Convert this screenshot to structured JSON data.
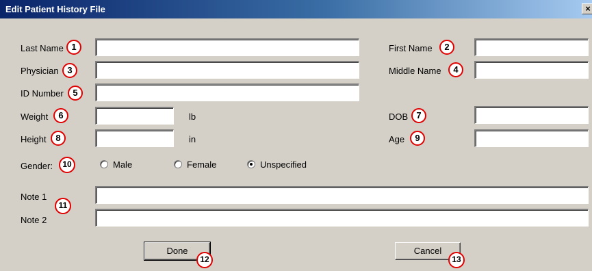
{
  "window": {
    "title": "Edit Patient History File",
    "close_glyph": "×"
  },
  "fields": {
    "last_name_label": "Last Name",
    "first_name_label": "First Name",
    "physician_label": "Physician",
    "middle_name_label": "Middle Name",
    "id_number_label": "ID Number",
    "weight_label": "Weight",
    "weight_unit": "lb",
    "dob_label": "DOB",
    "height_label": "Height",
    "height_unit": "in",
    "age_label": "Age",
    "gender_label": "Gender:",
    "note1_label": "Note 1",
    "note2_label": "Note 2",
    "values": {
      "last_name": "",
      "first_name": "",
      "physician": "",
      "middle_name": "",
      "id_number": "",
      "weight": "",
      "dob": "",
      "height": "",
      "age": "",
      "note1": "",
      "note2": ""
    }
  },
  "gender_options": [
    {
      "label": "Male",
      "selected": false
    },
    {
      "label": "Female",
      "selected": false
    },
    {
      "label": "Unspecified",
      "selected": true
    }
  ],
  "buttons": {
    "done": "Done",
    "cancel": "Cancel"
  },
  "callouts": [
    "1",
    "2",
    "3",
    "4",
    "5",
    "6",
    "7",
    "8",
    "9",
    "10",
    "11",
    "12",
    "13"
  ],
  "colors": {
    "dialog_bg": "#d4d0c8",
    "titlebar_start": "#0a246a",
    "titlebar_end": "#a6caf0",
    "callout_ring": "#e00000"
  }
}
